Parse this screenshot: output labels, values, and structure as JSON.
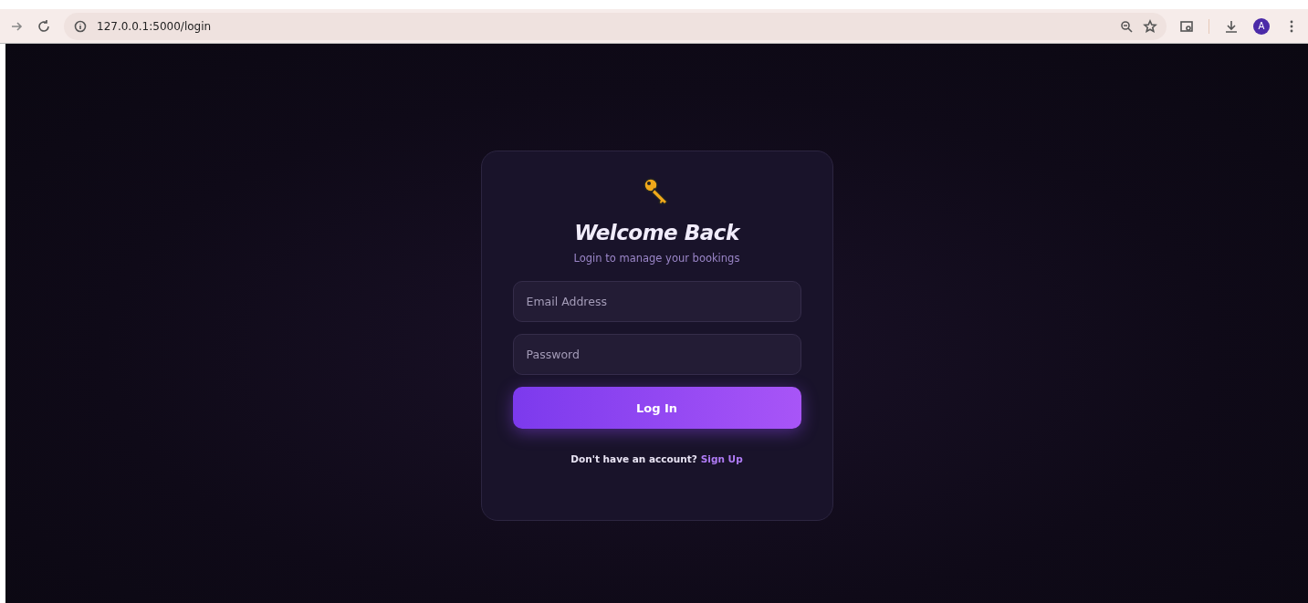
{
  "browser": {
    "url": "127.0.0.1:5000/login",
    "avatar": "A"
  },
  "login": {
    "title": "Welcome Back",
    "subtitle": "Login to manage your bookings",
    "fields": [
      {
        "placeholder": "Email Address"
      },
      {
        "placeholder": "Password"
      }
    ],
    "button": "Log In",
    "prompt": "Don't have an account?",
    "link": "Sign Up"
  }
}
